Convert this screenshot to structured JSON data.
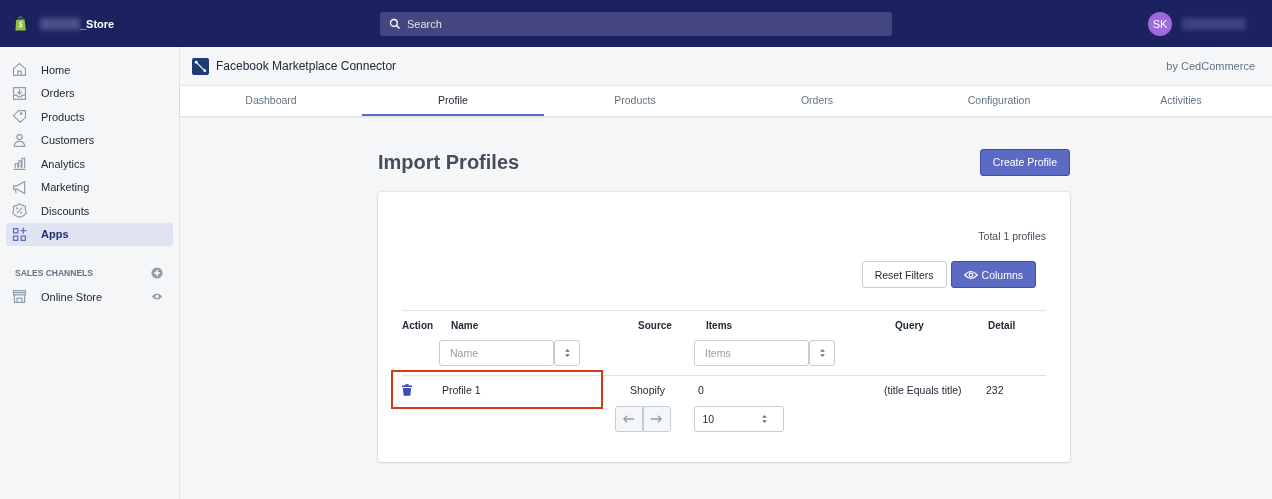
{
  "topbar": {
    "store_name": "_Store",
    "search": {
      "placeholder": "Search"
    },
    "avatar": "SK"
  },
  "sidebar": {
    "items": [
      {
        "label": "Home",
        "selected": false
      },
      {
        "label": "Orders",
        "selected": false
      },
      {
        "label": "Products",
        "selected": false
      },
      {
        "label": "Customers",
        "selected": false
      },
      {
        "label": "Analytics",
        "selected": false
      },
      {
        "label": "Marketing",
        "selected": false
      },
      {
        "label": "Discounts",
        "selected": false
      },
      {
        "label": "Apps",
        "selected": true
      }
    ],
    "section_title": "SALES CHANNELS",
    "channels": [
      {
        "label": "Online Store"
      }
    ]
  },
  "app_header": {
    "title": "Facebook Marketplace Connector",
    "vendor": "by CedCommerce"
  },
  "tabs": [
    {
      "label": "Dashboard",
      "selected": false
    },
    {
      "label": "Profile",
      "selected": true
    },
    {
      "label": "Products",
      "selected": false
    },
    {
      "label": "Orders",
      "selected": false
    },
    {
      "label": "Configuration",
      "selected": false
    },
    {
      "label": "Activities",
      "selected": false
    }
  ],
  "page": {
    "title": "Import Profiles",
    "primary_button": "Create Profile"
  },
  "card": {
    "total": "Total 1 profiles",
    "reset_button": "Reset Filters",
    "columns_button": "Columns",
    "table": {
      "columns": [
        {
          "label": "Action"
        },
        {
          "label": "Name",
          "filter_placeholder": "Name"
        },
        {
          "label": "Source"
        },
        {
          "label": "Items",
          "filter_placeholder": "Items"
        },
        {
          "label": "Query"
        },
        {
          "label": "Detail"
        }
      ],
      "rows": [
        {
          "name": "Profile 1",
          "source": "Shopify",
          "items": "0",
          "query": "(title Equals title)",
          "detail": "232",
          "highlighted": true
        }
      ]
    },
    "page_size": "10"
  }
}
